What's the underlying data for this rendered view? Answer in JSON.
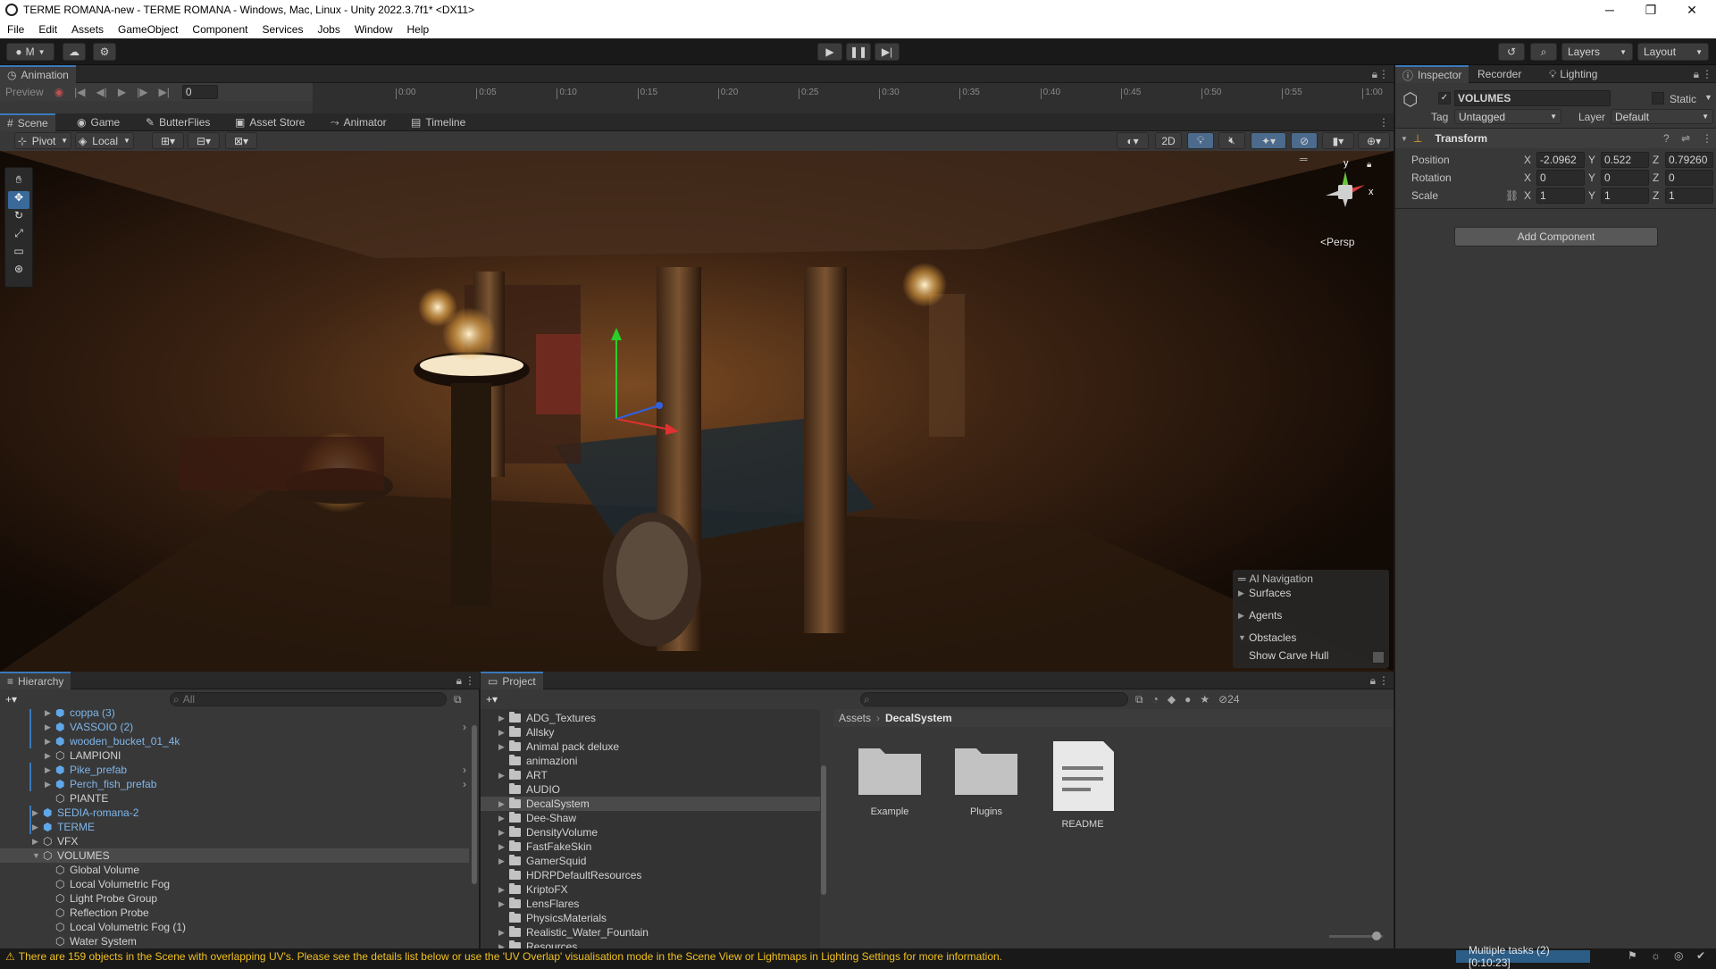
{
  "window": {
    "title": "TERME ROMANA-new - TERME ROMANA - Windows, Mac, Linux - Unity 2022.3.7f1* <DX11>",
    "controls": [
      "─",
      "❐",
      "✕"
    ]
  },
  "menu": [
    "File",
    "Edit",
    "Assets",
    "GameObject",
    "Component",
    "Services",
    "Jobs",
    "Window",
    "Help"
  ],
  "toolbar": {
    "account": "M",
    "layers_label": "Layers",
    "layout_label": "Layout"
  },
  "animation": {
    "tab": "Animation",
    "preview": "Preview",
    "frame": "0",
    "times": [
      "0:00",
      "0:05",
      "0:10",
      "0:15",
      "0:20",
      "0:25",
      "0:30",
      "0:35",
      "0:40",
      "0:45",
      "0:50",
      "0:55",
      "1:00"
    ]
  },
  "scene_tabs": [
    "Scene",
    "Game",
    "ButterFlies",
    "Asset Store",
    "Animator",
    "Timeline"
  ],
  "scene_toolbar": {
    "pivot": "Pivot",
    "local": "Local",
    "mode_2d": "2D"
  },
  "gizmo": {
    "persp": "Persp",
    "y": "y",
    "x": "x"
  },
  "ai_navigation": {
    "title": "AI Navigation",
    "items": [
      "Surfaces",
      "Agents",
      "Obstacles"
    ],
    "show_carve": "Show Carve Hull"
  },
  "hierarchy": {
    "tab": "Hierarchy",
    "search_placeholder": "All",
    "items": [
      {
        "label": "coppa (3)",
        "prefab": true
      },
      {
        "label": "VASSOIO (2)",
        "prefab": true
      },
      {
        "label": "wooden_bucket_01_4k",
        "prefab": true
      },
      {
        "label": "LAMPIONI",
        "prefab": false
      },
      {
        "label": "Pike_prefab",
        "prefab": true
      },
      {
        "label": "Perch_fish_prefab",
        "prefab": true
      },
      {
        "label": "PIANTE",
        "prefab": false
      },
      {
        "label": "SEDIA-romana-2",
        "prefab": true
      },
      {
        "label": "TERME",
        "prefab": true
      },
      {
        "label": "VFX",
        "prefab": false
      },
      {
        "label": "VOLUMES",
        "prefab": false
      },
      {
        "label": "Global Volume",
        "prefab": false
      },
      {
        "label": "Local Volumetric Fog",
        "prefab": false
      },
      {
        "label": "Light Probe Group",
        "prefab": false
      },
      {
        "label": "Reflection Probe",
        "prefab": false
      },
      {
        "label": "Local Volumetric Fog (1)",
        "prefab": false
      },
      {
        "label": "Water System",
        "prefab": false
      }
    ]
  },
  "project": {
    "tab": "Project",
    "folders": [
      "ADG_Textures",
      "Allsky",
      "Animal pack deluxe",
      "animazioni",
      "ART",
      "AUDIO",
      "DecalSystem",
      "Dee-Shaw",
      "DensityVolume",
      "FastFakeSkin",
      "GamerSquid",
      "HDRPDefaultResources",
      "KriptoFX",
      "LensFlares",
      "PhysicsMaterials",
      "Realistic_Water_Fountain",
      "Resources"
    ],
    "breadcrumb_root": "Assets",
    "breadcrumb_current": "DecalSystem",
    "assets": [
      "Example",
      "Plugins",
      "README"
    ],
    "hidden_count": "24"
  },
  "inspector": {
    "tabs": [
      "Inspector",
      "Recorder",
      "Lighting"
    ],
    "object_name": "VOLUMES",
    "static_label": "Static",
    "tag_label": "Tag",
    "tag_value": "Untagged",
    "layer_label": "Layer",
    "layer_value": "Default",
    "component": "Transform",
    "position_label": "Position",
    "rotation_label": "Rotation",
    "scale_label": "Scale",
    "position": {
      "x": "-2.0962",
      "y": "0.522",
      "z": "0.79260"
    },
    "rotation": {
      "x": "0",
      "y": "0",
      "z": "0"
    },
    "scale": {
      "x": "1",
      "y": "1",
      "z": "1"
    },
    "axis": {
      "x": "X",
      "y": "Y",
      "z": "Z"
    },
    "add_component": "Add Component"
  },
  "status": {
    "warning": "There are 159 objects in the Scene with overlapping UV's. Please see the details list below or use the 'UV Overlap' visualisation mode in the Scene View or Lightmaps in Lighting Settings for more information.",
    "tasks": "Multiple tasks (2) [0:10:23]"
  }
}
